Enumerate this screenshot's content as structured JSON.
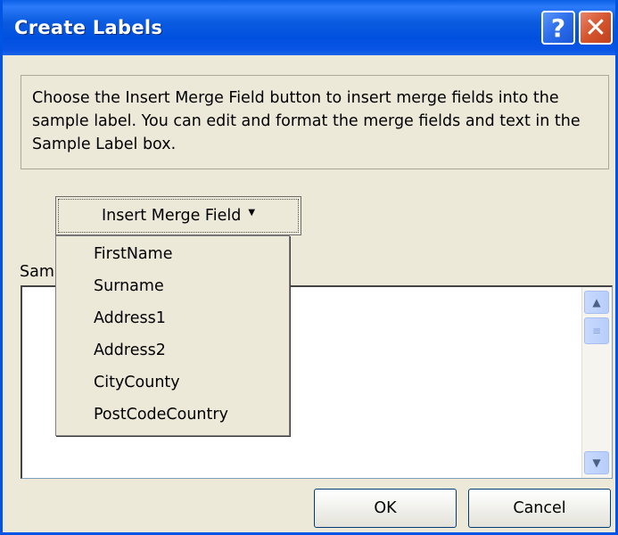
{
  "window": {
    "title": "Create Labels",
    "help_label": "?",
    "close_label": "✕"
  },
  "instructions": "Choose the Insert Merge Field button to insert merge fields into the sample label.  You can edit and format the merge fields and text in the Sample Label box.",
  "merge_button": {
    "label": "Insert Merge Field",
    "caret": "▼"
  },
  "sample_label": {
    "label": "Sam"
  },
  "dropdown": {
    "items": [
      "FirstName",
      "Surname",
      "Address1",
      "Address2",
      "CityCounty",
      "PostCodeCountry"
    ]
  },
  "buttons": {
    "ok": "OK",
    "cancel": "Cancel"
  },
  "colors": {
    "titlebar": "#0054E3",
    "dialog_bg": "#ECE9D8",
    "close": "#D5552E"
  }
}
